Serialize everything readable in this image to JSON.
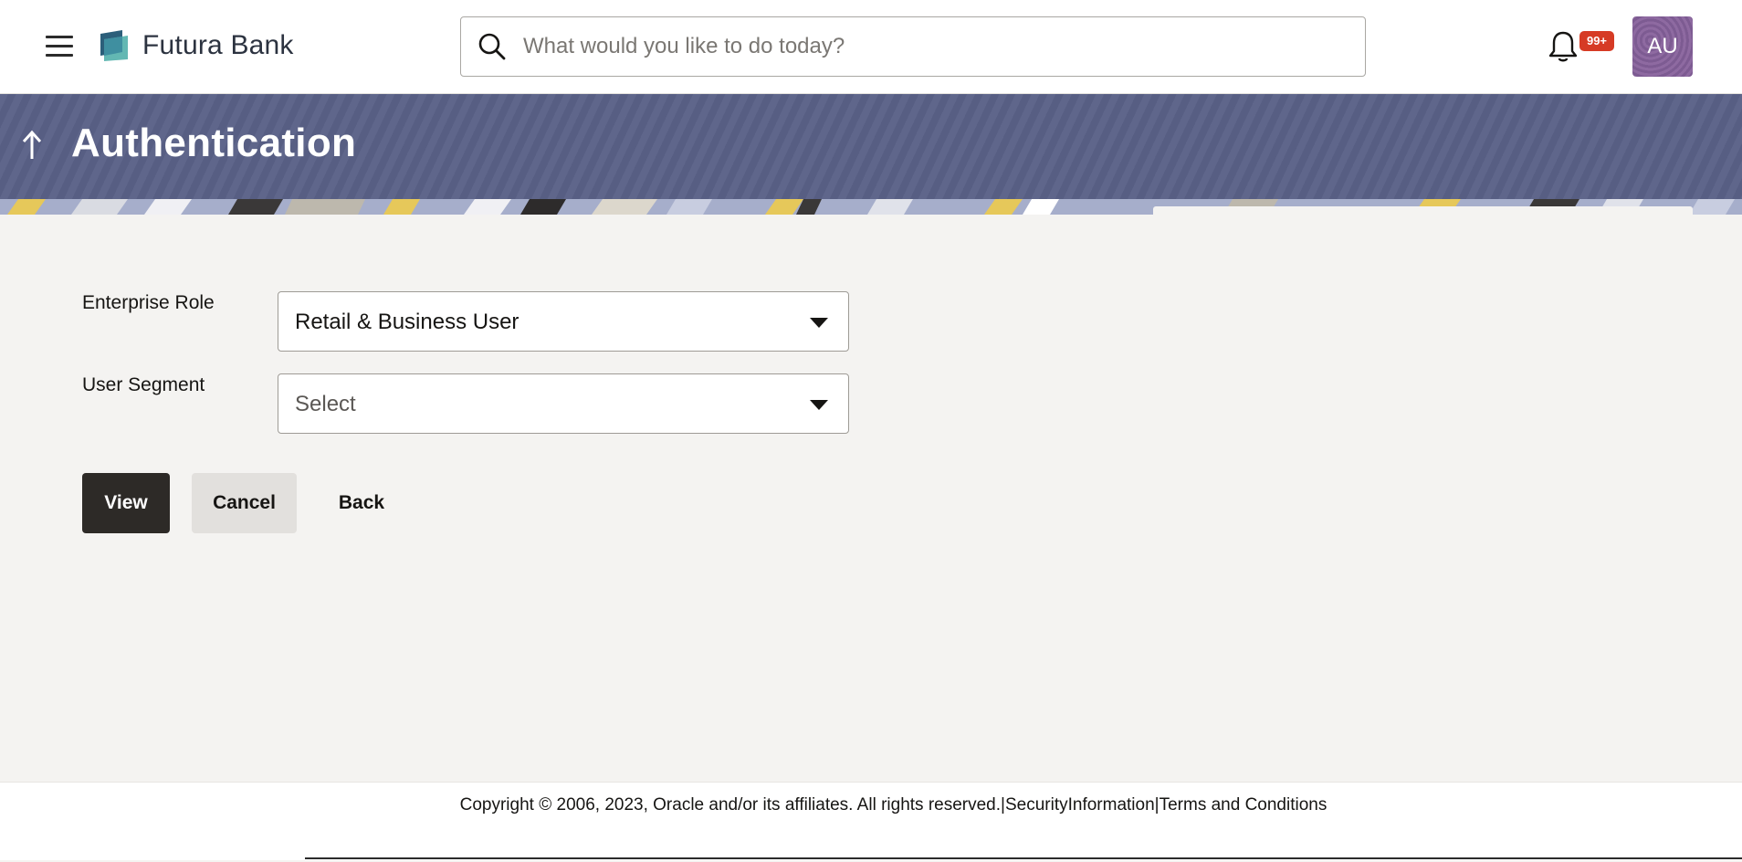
{
  "header": {
    "brand": "Futura Bank",
    "search_placeholder": "What would you like to do today?",
    "notification_count": "99+",
    "avatar_initials": "AU"
  },
  "page": {
    "title": "Authentication"
  },
  "form": {
    "enterprise_role_label": "Enterprise Role",
    "enterprise_role_value": "Retail & Business User",
    "user_segment_label": "User Segment",
    "user_segment_value": "Select"
  },
  "actions": {
    "view_label": "View",
    "cancel_label": "Cancel",
    "back_label": "Back"
  },
  "footer": {
    "copyright": "Copyright © 2006, 2023, Oracle and/or its affiliates. All rights reserved.",
    "separator": "|",
    "security_link": "SecurityInformation",
    "terms_link": "Terms and Conditions"
  },
  "colors": {
    "title_band": "#5a6187",
    "primary_button": "#2d2a27",
    "badge": "#d63b25",
    "avatar": "#8e6aa1"
  }
}
